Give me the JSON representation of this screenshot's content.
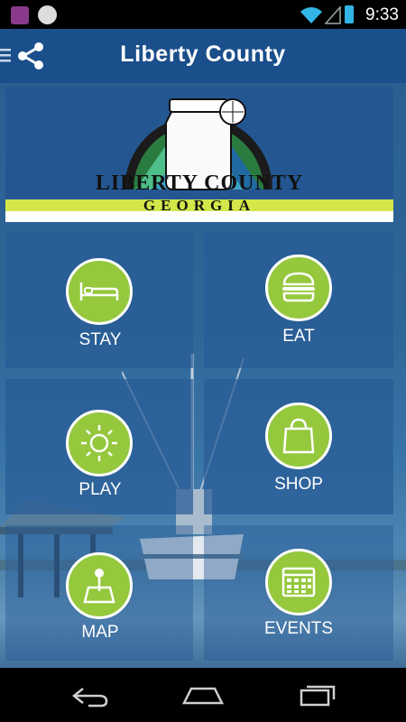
{
  "status_bar": {
    "time": "9:33"
  },
  "app_bar": {
    "title": "Liberty County"
  },
  "logo": {
    "line1": "LIBERTY COUNTY",
    "line2": "GEORGIA"
  },
  "tiles": [
    {
      "label": "STAY",
      "icon": "bed-icon"
    },
    {
      "label": "EAT",
      "icon": "burger-icon"
    },
    {
      "label": "PLAY",
      "icon": "sun-icon"
    },
    {
      "label": "SHOP",
      "icon": "shopping-bag-icon"
    },
    {
      "label": "MAP",
      "icon": "map-pin-icon"
    },
    {
      "label": "EVENTS",
      "icon": "calendar-icon"
    }
  ],
  "colors": {
    "app_bar": "#1b4f8c",
    "icon_circle": "#95c83d",
    "logo_band": "#d3e74a"
  }
}
